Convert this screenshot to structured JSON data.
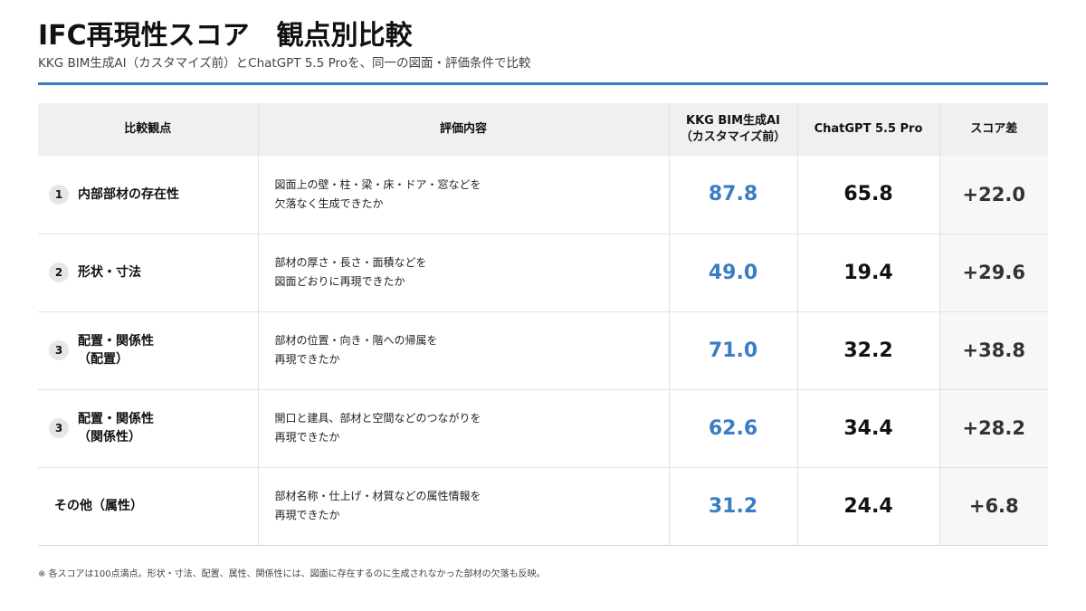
{
  "header": {
    "title": "IFC再現性スコア　観点別比較",
    "subtitle": "KKG BIM生成AI（カスタマイズ前）とChatGPT 5.5 Proを、同一の図面・評価条件で比較"
  },
  "table": {
    "columns": {
      "axis": "比較観点",
      "desc": "評価内容",
      "kkg": "KKG BIM生成AI\n（カスタマイズ前）",
      "gpt": "ChatGPT 5.5 Pro",
      "diff": "スコア差"
    },
    "rows": [
      {
        "index": "1",
        "label": "内部部材の存在性",
        "desc": "図面上の壁・柱・梁・床・ドア・窓などを\n欠落なく生成できたか",
        "kkg": "87.8",
        "gpt": "65.8",
        "diff": "+22.0"
      },
      {
        "index": "2",
        "label": "形状・寸法",
        "desc": "部材の厚さ・長さ・面積などを\n図面どおりに再現できたか",
        "kkg": "49.0",
        "gpt": "19.4",
        "diff": "+29.6"
      },
      {
        "index": "3",
        "label": "配置・関係性\n（配置）",
        "desc": "部材の位置・向き・階への帰属を\n再現できたか",
        "kkg": "71.0",
        "gpt": "32.2",
        "diff": "+38.8"
      },
      {
        "index": "3",
        "label": "配置・関係性\n（関係性）",
        "desc": "開口と建具、部材と空間などのつながりを\n再現できたか",
        "kkg": "62.6",
        "gpt": "34.4",
        "diff": "+28.2"
      },
      {
        "index": "",
        "label": "その他（属性）",
        "desc": "部材名称・仕上げ・材質などの属性情報を\n再現できたか",
        "kkg": "31.2",
        "gpt": "24.4",
        "diff": "+6.8"
      }
    ]
  },
  "footnote": "※ 各スコアは100点満点。形状・寸法、配置、属性、関係性には、図面に存在するのに生成されなかった部材の欠落も反映。",
  "colors": {
    "accent": "#3b79c0",
    "kkg_score": "#3a7dc4",
    "header_bg": "#f0f0f0"
  }
}
